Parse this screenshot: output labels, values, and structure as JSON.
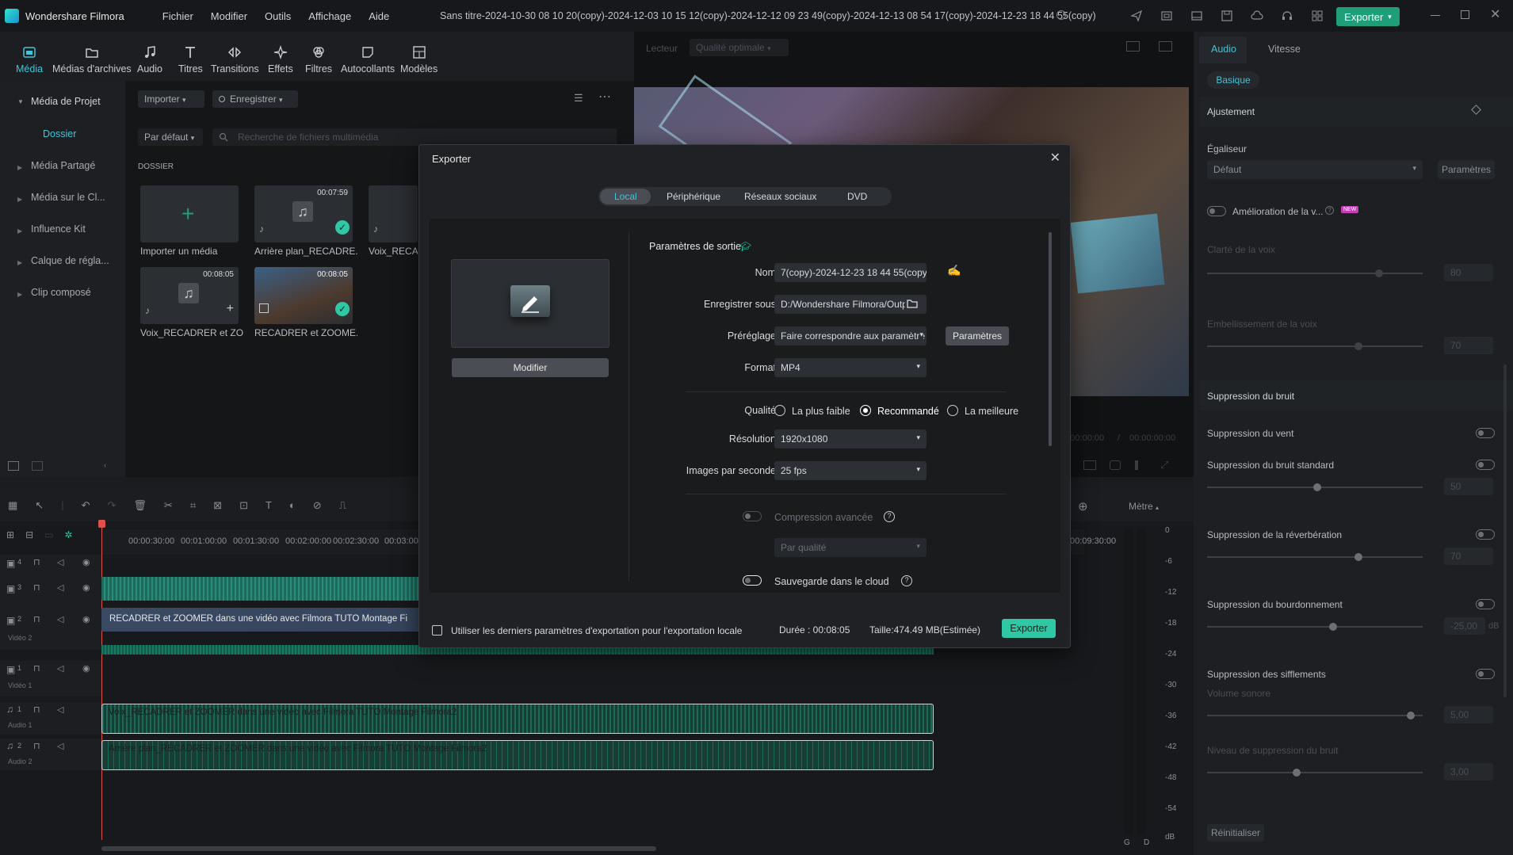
{
  "app": {
    "name": "Wondershare Filmora",
    "title": "Sans titre-2024-10-30 08 10 20(copy)-2024-12-03 10 15 12(copy)-2024-12-12 09 23 49(copy)-2024-12-13 08 54 17(copy)-2024-12-23 18 44 55(copy)",
    "export_label": "Exporter"
  },
  "menu": [
    "Fichier",
    "Modifier",
    "Outils",
    "Affichage",
    "Aide"
  ],
  "toolbar": [
    "Média",
    "Médias d'archives",
    "Audio",
    "Titres",
    "Transitions",
    "Effets",
    "Filtres",
    "Autocollants",
    "Modèles"
  ],
  "sidebar": {
    "items": [
      "Média de Projet",
      "Dossier",
      "Média Partagé",
      "Média sur le Cl...",
      "Influence Kit",
      "Calque de régla...",
      "Clip composé"
    ]
  },
  "media": {
    "import_label": "Importer",
    "record_label": "Enregistrer",
    "sort_label": "Par défaut",
    "search_placeholder": "Recherche de fichiers multimédia",
    "folder_heading": "DOSSIER",
    "items": [
      {
        "label": "Importer un média",
        "duration": ""
      },
      {
        "label": "Arrière plan_RECADRE...",
        "duration": "00:07:59"
      },
      {
        "label": "Voix_RECAD",
        "duration": ""
      },
      {
        "label": "Voix_RECADRER et ZO...",
        "duration": "00:08:05"
      },
      {
        "label": "RECADRER et ZOOME...",
        "duration": "00:08:05"
      }
    ]
  },
  "player": {
    "label": "Lecteur",
    "quality": "Qualité optimale",
    "time_current": "00:00:00:00",
    "time_total": "00:00:00:00"
  },
  "right_panel": {
    "tabs": [
      "Audio",
      "Vitesse"
    ],
    "subtab": "Basique",
    "section_adjust": "Ajustement",
    "equalizer_label": "Égaliseur",
    "equalizer_value": "Défaut",
    "params_label": "Paramètres",
    "voice_enh_label": "Amélioration de la v...",
    "new_badge": "NEW",
    "clarity_label": "Clarté de la voix",
    "clarity_value": "80",
    "embellish_label": "Embellissement de la voix",
    "embellish_value": "70",
    "noise_section": "Suppression du bruit",
    "wind_label": "Suppression du vent",
    "standard_label": "Suppression du bruit standard",
    "standard_value": "50",
    "reverb_label": "Suppression de la réverbération",
    "reverb_value": "70",
    "hum_label": "Suppression du bourdonnement",
    "hum_value": "-25,00",
    "hum_unit": "dB",
    "hiss_label": "Suppression des sifflements",
    "volume_label": "Volume sonore",
    "volume_value": "5,00",
    "noise_level_label": "Niveau de suppression du bruit",
    "noise_level_value": "3,00",
    "reset_label": "Réinitialiser"
  },
  "timeline": {
    "ruler": [
      "00:00:30:00",
      "00:01:00:00",
      "00:01:30:00",
      "00:02:00:00",
      "00:02:30:00",
      "00:03:00",
      "00:09:30:00"
    ],
    "meter_label": "Mètre",
    "meter_ticks": [
      "0",
      "-6",
      "-12",
      "-18",
      "-24",
      "-30",
      "-36",
      "-42",
      "-48",
      "-54",
      "dB"
    ],
    "meter_channels": [
      "G",
      "D"
    ],
    "tracks": [
      {
        "label": "",
        "num": "4"
      },
      {
        "label": "",
        "num": "3"
      },
      {
        "label": "Vidéo 2",
        "num": "2"
      },
      {
        "label": "Vidéo 1",
        "num": "1"
      },
      {
        "label": "Audio 1",
        "num": "1"
      },
      {
        "label": "Audio 2",
        "num": "2"
      }
    ],
    "clip_video": "RECADRER et ZOOMER dans une vidéo avec Filmora  TUTO Montage Fi",
    "clip_audio1": "Voix_RECADRER et ZOOMER dans une vidéo avec Filmora  TUTO Montage Filmora2",
    "clip_audio2": "Arrière plan_RECADRER et ZOOMER dans une vidéo avec Filmora  TUTO Montage Filmora2"
  },
  "dialog": {
    "title": "Exporter",
    "tabs": [
      "Local",
      "Périphérique",
      "Réseaux sociaux",
      "DVD"
    ],
    "modify_label": "Modifier",
    "output_heading": "Paramètres de sortie",
    "name_label": "Nom",
    "name_value": "7(copy)-2024-12-23 18 44 55(copy)",
    "save_label": "Enregistrer sous",
    "save_value": "D:/Wondershare Filmora/Outp",
    "preset_label": "Préréglage",
    "preset_value": "Faire correspondre aux paramètre",
    "params_button": "Paramètres",
    "format_label": "Format",
    "format_value": "MP4",
    "quality_label": "Qualité",
    "quality_options": [
      "La plus faible",
      "Recommandé",
      "La meilleure"
    ],
    "resolution_label": "Résolution",
    "resolution_value": "1920x1080",
    "fps_label": "Images par seconde",
    "fps_value": "25 fps",
    "compression_label": "Compression avancée",
    "compression_mode": "Par qualité",
    "cloud_label": "Sauvegarde dans le cloud",
    "use_last_label": "Utiliser les derniers paramètres d'exportation pour l'exportation locale",
    "duration_label": "Durée : 00:08:05",
    "size_label": "Taille:474.49 MB(Estimée)",
    "export_button": "Exporter"
  },
  "colors": {
    "accent": "#1f9e7a",
    "bg": "#1a1c1f",
    "dialog": "#1f2124"
  }
}
